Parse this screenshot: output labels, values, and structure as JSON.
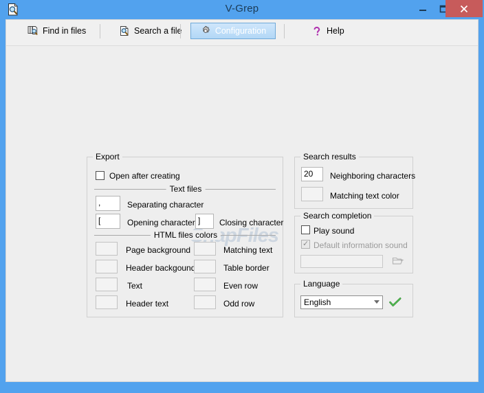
{
  "window": {
    "title": "V-Grep",
    "app_icon": "document-search-icon",
    "accent_color": "#52a2ee",
    "close_button_color": "#c75b5b",
    "client_background": "#eeeeee",
    "controls": {
      "minimize": "minimize",
      "maximize": "maximize",
      "close": "close"
    }
  },
  "toolbar": {
    "buttons": [
      {
        "id": "find-in-files",
        "label": "Find in files",
        "icon": "files-search-icon",
        "active": false
      },
      {
        "id": "search-a-file",
        "label": "Search a file",
        "icon": "document-search-icon",
        "active": false
      },
      {
        "id": "configuration",
        "label": "Configuration",
        "icon": "gear-icon",
        "active": true
      },
      {
        "id": "help",
        "label": "Help",
        "icon": "question-mark-icon",
        "active": false
      }
    ]
  },
  "export_group": {
    "title": "Export",
    "open_after_creating": {
      "label": "Open after creating",
      "checked": false
    },
    "text_files": {
      "caption": "Text files",
      "separating": {
        "value": ",",
        "label": "Separating character"
      },
      "opening": {
        "value": "[",
        "label": "Opening character"
      },
      "closing": {
        "value": "]",
        "label": "Closing character"
      }
    },
    "html_colors": {
      "caption": "HTML files colors",
      "left": [
        {
          "label": "Page background",
          "color": "#f3f3f3"
        },
        {
          "label": "Header backgound",
          "color": "#f3f3f3"
        },
        {
          "label": "Text",
          "color": "#f3f3f3"
        },
        {
          "label": "Header text",
          "color": "#f3f3f3"
        }
      ],
      "right": [
        {
          "label": "Matching text",
          "color": "#f3f3f3"
        },
        {
          "label": "Table border",
          "color": "#f3f3f3"
        },
        {
          "label": "Even row",
          "color": "#f3f3f3"
        },
        {
          "label": "Odd row",
          "color": "#f3f3f3"
        }
      ]
    }
  },
  "search_results_group": {
    "title": "Search results",
    "neighboring": {
      "value": "20",
      "label": "Neighboring characters"
    },
    "matching_color": {
      "label": "Matching text color",
      "color": "#f3f3f3"
    }
  },
  "search_completion_group": {
    "title": "Search completion",
    "play_sound": {
      "label": "Play sound",
      "checked": false,
      "disabled": false
    },
    "default_sound": {
      "label": "Default information sound",
      "checked": true,
      "disabled": true
    },
    "sound_path": {
      "value": "",
      "disabled": true
    },
    "browse_icon": "open-folder-icon"
  },
  "language_group": {
    "title": "Language",
    "selected": "English",
    "options": [
      "English"
    ],
    "apply_icon": "green-check-icon"
  },
  "watermark": {
    "text": "SnapFiles"
  }
}
